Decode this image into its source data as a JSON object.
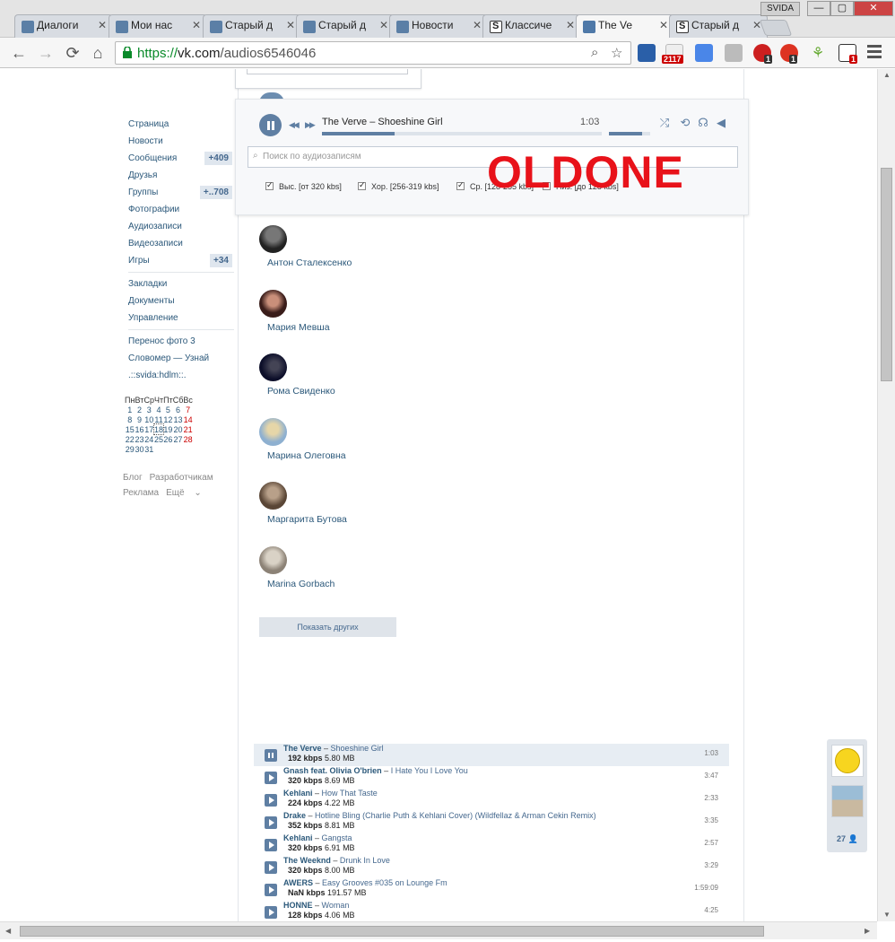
{
  "browser": {
    "tabs": [
      {
        "label": "Диалоги",
        "icon": "vk-messages-icon"
      },
      {
        "label": "Мои нас",
        "icon": "vk-icon"
      },
      {
        "label": "Старый д",
        "icon": "vk-icon"
      },
      {
        "label": "Старый д",
        "icon": "vk-icon"
      },
      {
        "label": "Новости",
        "icon": "vk-icon"
      },
      {
        "label": "Классиче",
        "icon": "s-icon"
      },
      {
        "label": "The Ve",
        "icon": "play-icon"
      },
      {
        "label": "Старый д",
        "icon": "s-icon"
      }
    ],
    "profile": "SVIDA",
    "url_scheme": "https://",
    "url_host": "vk.com",
    "url_path": "/audios6546046",
    "ext_badges": {
      "music": "2117",
      "opera": "1",
      "abp": "1",
      "s": "1"
    }
  },
  "nav": {
    "items": [
      {
        "label": "Страница",
        "count": ""
      },
      {
        "label": "Новости",
        "count": ""
      },
      {
        "label": "Сообщения",
        "count": "+409"
      },
      {
        "label": "Друзья",
        "count": ""
      },
      {
        "label": "Группы",
        "count": "+..708"
      },
      {
        "label": "Фотографии",
        "count": ""
      },
      {
        "label": "Аудиозаписи",
        "count": ""
      },
      {
        "label": "Видеозаписи",
        "count": ""
      },
      {
        "label": "Игры",
        "count": "+34"
      }
    ],
    "items2": [
      "Закладки",
      "Документы",
      "Управление"
    ],
    "items3": [
      "Перенос фото 3",
      "Словомер — Узнай",
      ".::svida:hdlm::."
    ]
  },
  "calendar": {
    "headers": [
      "Пн",
      "Вт",
      "Ср",
      "Чт",
      "Пт",
      "Сб",
      "Вс"
    ],
    "weeks": [
      [
        "1",
        "2",
        "3",
        "4",
        "5",
        "6",
        "7"
      ],
      [
        "8",
        "9",
        "10",
        "11",
        "12",
        "13",
        "14"
      ],
      [
        "15",
        "16",
        "17",
        "18",
        "19",
        "20",
        "21"
      ],
      [
        "22",
        "23",
        "24",
        "25",
        "26",
        "27",
        "28"
      ],
      [
        "29",
        "30",
        "31",
        "",
        "",
        "",
        ""
      ]
    ],
    "today": "18"
  },
  "footer": {
    "blog": "Блог",
    "dev": "Разработчикам",
    "ads": "Реклама",
    "more": "Ещё"
  },
  "player": {
    "title": "The Verve – Shoeshine Girl",
    "time": "1:03",
    "progress": 0.26,
    "volume": 0.8,
    "search_placeholder": "Поиск по аудиозаписям",
    "filters": [
      "Выс. [от 320 kbs]",
      "Хор. [256-319 kbs]",
      "Ср. [128-255 kbs]",
      "Низ. [до 128 kbs]"
    ]
  },
  "watermark": "OLDONE",
  "friends": [
    "Антон Сталексенко",
    "Мария Мевша",
    "Рома Свиденко",
    "Марина Олеговна",
    "Маргарита Бутова",
    "Marina Gorbach"
  ],
  "show_more": "Показать других",
  "audio": [
    {
      "artist": "The Verve",
      "song": "Shoeshine Girl",
      "kbps": "192 kbps",
      "size": "5.80 MB",
      "dur": "1:03",
      "active": true
    },
    {
      "artist": "Gnash feat. Olivia O'brien",
      "song": "I Hate You I Love You",
      "kbps": "320 kbps",
      "size": "8.69 MB",
      "dur": "3:47"
    },
    {
      "artist": "Kehlani",
      "song": "How That Taste",
      "kbps": "224 kbps",
      "size": "4.22 MB",
      "dur": "2:33"
    },
    {
      "artist": "Drake",
      "song": "Hotline Bling (Charlie Puth & Kehlani Cover) (Wildfellaz & Arman Cekin Remix)",
      "kbps": "352 kbps",
      "size": "8.81 MB",
      "dur": "3:35"
    },
    {
      "artist": "Kehlani",
      "song": "Gangsta",
      "kbps": "320 kbps",
      "size": "6.91 MB",
      "dur": "2:57"
    },
    {
      "artist": "The Weeknd",
      "song": "Drunk In Love",
      "kbps": "320 kbps",
      "size": "8.00 MB",
      "dur": "3:29"
    },
    {
      "artist": "AWERS",
      "song": "Easy Grooves #035 on Lounge Fm",
      "kbps": "NaN kbps",
      "size": "191.57 MB",
      "dur": "1:59:09"
    },
    {
      "artist": "HONNE",
      "song": "Woman",
      "kbps": "128 kbps",
      "size": "4.06 MB",
      "dur": "4:25"
    }
  ],
  "chat": {
    "count": "27"
  }
}
